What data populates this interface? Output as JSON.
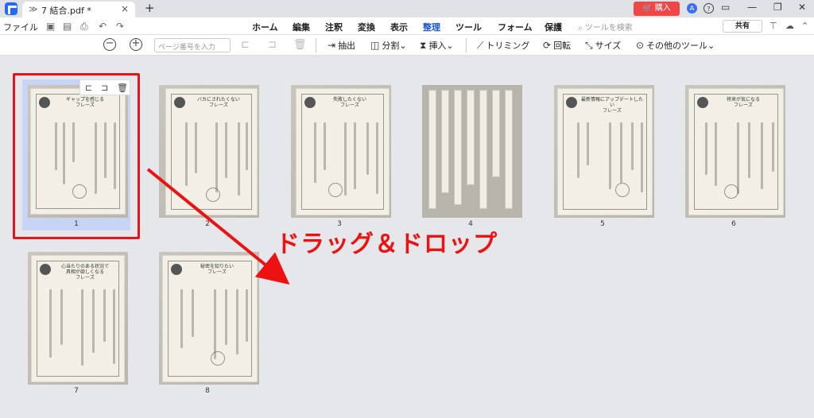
{
  "titlebar": {
    "tab_title": "7 結合.pdf *",
    "tab_close": "×",
    "new_tab": "+",
    "buy_label": "🛒 購入",
    "window_controls": [
      "—",
      "❐",
      "✕"
    ]
  },
  "menubar": {
    "file_label": "ファイル",
    "nav": [
      "ホーム",
      "編集",
      "注釈",
      "変換",
      "表示",
      "整理",
      "ツール",
      "フォーム",
      "保護"
    ],
    "active_nav": "整理",
    "search_placeholder": "ツールを検索",
    "share_label": "共有"
  },
  "toolbar": {
    "page_input_placeholder": "ページ番号を入力",
    "extract": "抽出",
    "split": "分割⌄",
    "insert": "挿入⌄",
    "crop": "トリミング",
    "rotate": "回転",
    "size": "サイズ",
    "more_tools": "その他のツール⌄"
  },
  "pages": [
    {
      "number": "1",
      "heading": "ギャップを感じる\nフレーズ",
      "selected": true
    },
    {
      "number": "2",
      "heading": "バカにされたくない\nフレーズ",
      "selected": false
    },
    {
      "number": "3",
      "heading": "失敗したくない\nフレーズ",
      "selected": false
    },
    {
      "number": "4",
      "heading": "",
      "selected": false
    },
    {
      "number": "5",
      "heading": "最新情報にアップデートしたい\nフレーズ",
      "selected": false
    },
    {
      "number": "6",
      "heading": "将来が気になる\nフレーズ",
      "selected": false
    },
    {
      "number": "7",
      "heading": "心当たりのある状況で\n具相が欲しくなる\nフレーズ",
      "selected": false
    },
    {
      "number": "8",
      "heading": "秘密を知りたい\nフレーズ",
      "selected": false
    }
  ],
  "annotation": {
    "label": "ドラッグ＆ドロップ",
    "color": "#ee1111"
  },
  "colors": {
    "accent": "#1a57d6",
    "buy_button": "#ef4747",
    "selection": "#c7d4f3"
  },
  "icons": [
    "app-logo-icon",
    "tab-page-icon",
    "save-icon",
    "print-icon",
    "undo-icon",
    "redo-icon",
    "zoom-out-icon",
    "zoom-in-icon",
    "extract-icon",
    "split-icon",
    "insert-icon",
    "crop-icon",
    "rotate-icon",
    "size-icon",
    "more-icon"
  ]
}
